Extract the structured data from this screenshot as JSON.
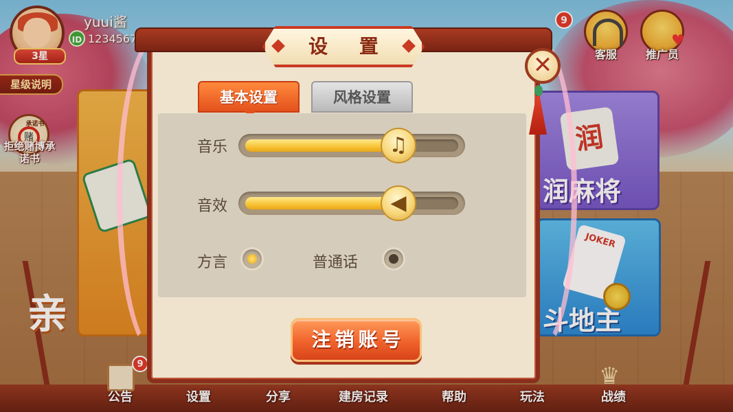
{
  "profile": {
    "username": "yuui酱",
    "id_label": "ID",
    "user_id": "1234567",
    "star_level": "3星",
    "star_explain": "星级说明"
  },
  "pledge": {
    "sub_label": "承诺书",
    "ban_glyph": "赌",
    "label": "拒绝赌博承诺书"
  },
  "top_right": {
    "mail_badge": "9",
    "customer_service": "客服",
    "promoter": "推广员"
  },
  "game_cards": {
    "left_glyph": "亲",
    "purple_tile": "润",
    "purple_title": "润麻将",
    "blue_joker": "JOKER",
    "blue_title": "斗地主"
  },
  "dialog": {
    "title": "设 置",
    "close_glyph": "✕",
    "tabs": [
      {
        "label": "基本设置",
        "active": true
      },
      {
        "label": "风格设置",
        "active": false
      }
    ],
    "music": {
      "label": "音乐",
      "level": 0.72,
      "icon": "music-note-icon",
      "glyph": "♫"
    },
    "sound": {
      "label": "音效",
      "level": 0.72,
      "icon": "speaker-icon",
      "glyph": "◀"
    },
    "language": {
      "options": [
        {
          "label": "方言",
          "selected": true
        },
        {
          "label": "普通话",
          "selected": false
        }
      ]
    },
    "logout_label": "注销账号"
  },
  "bottom_nav": {
    "notice_badge": "9",
    "items": [
      "公告",
      "设置",
      "分享",
      "建房记录",
      "帮助",
      "玩法",
      "战绩"
    ]
  },
  "colors": {
    "accent": "#e4511c",
    "frame": "#8b2e1c",
    "panel": "#efe3cd",
    "slider_fill": "#f7c335"
  }
}
